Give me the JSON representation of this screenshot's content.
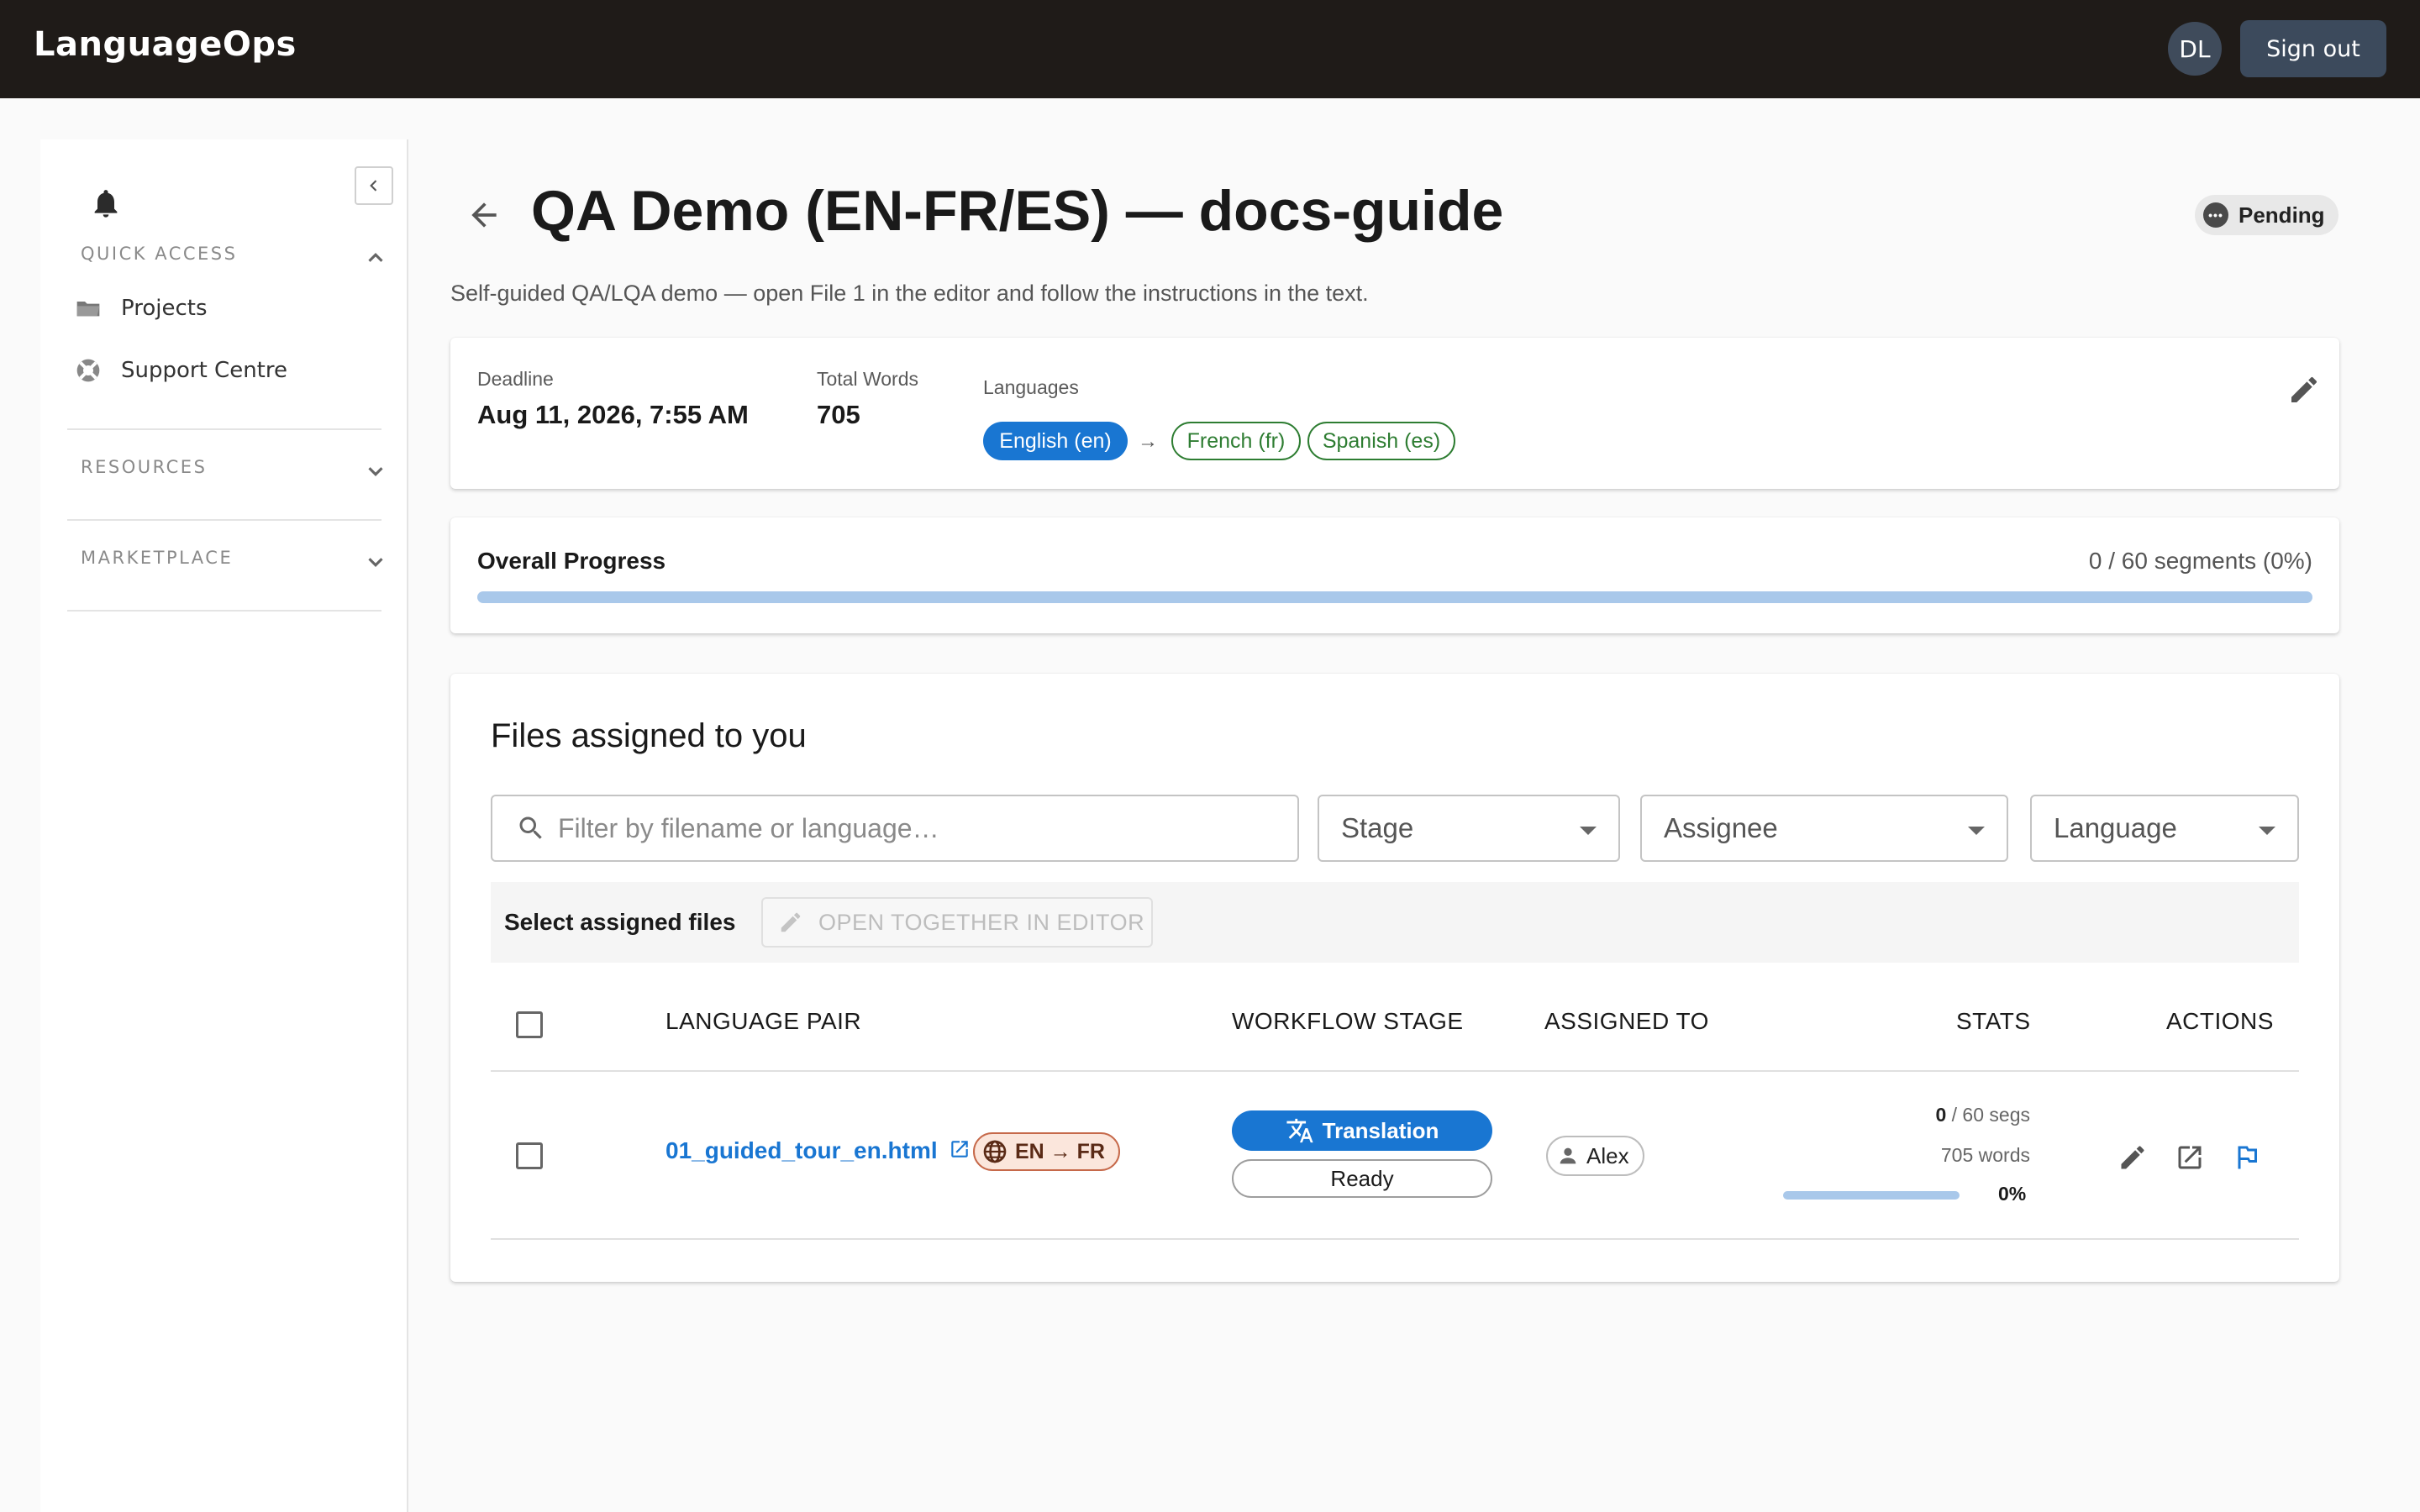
{
  "app": {
    "brand": "LanguageOps"
  },
  "user": {
    "initials": "DL",
    "signout_label": "Sign out"
  },
  "sidebar": {
    "sections": [
      {
        "title": "QUICK ACCESS",
        "expanded": true,
        "items": [
          {
            "label": "Projects",
            "icon": "folder-icon"
          },
          {
            "label": "Support Centre",
            "icon": "lifebuoy-icon"
          }
        ]
      },
      {
        "title": "RESOURCES",
        "expanded": false
      },
      {
        "title": "MARKETPLACE",
        "expanded": false
      }
    ]
  },
  "project": {
    "title": "QA Demo (EN-FR/ES) — docs-guide",
    "status": "Pending",
    "description": "Self-guided QA/LQA demo — open File 1 in the editor and follow the instructions in the text.",
    "meta": {
      "deadline_label": "Deadline",
      "deadline_value": "Aug 11, 2026, 7:55 AM",
      "words_label": "Total Words",
      "words_value": "705",
      "languages_label": "Languages",
      "source_language": "English (en)",
      "arrow": "→",
      "target_languages": [
        "French (fr)",
        "Spanish (es)"
      ]
    }
  },
  "progress": {
    "title": "Overall Progress",
    "text": "0 / 60 segments (0%)",
    "fraction": 0
  },
  "files": {
    "title": "Files assigned to you",
    "search_placeholder": "Filter by filename or language…",
    "filters": {
      "stage": "Stage",
      "assignee": "Assignee",
      "language": "Language"
    },
    "bulk": {
      "label": "Select assigned files",
      "button": "OPEN TOGETHER IN EDITOR"
    },
    "columns": [
      "LANGUAGE PAIR",
      "WORKFLOW STAGE",
      "ASSIGNED TO",
      "STATS",
      "ACTIONS"
    ],
    "rows": [
      {
        "filename": "01_guided_tour_en.html",
        "pair": "EN → FR",
        "stage": "Translation",
        "stage_status": "Ready",
        "assignee": "Alex",
        "segs_done": "0",
        "segs_total": " / 60 segs",
        "words": "705 words",
        "percent": "0%",
        "fraction": 0
      }
    ]
  },
  "colors": {
    "primary": "#1976d2",
    "topbar": "#1f1b18",
    "target_chip": "#2e7d32",
    "pair_badge_bg": "#fbe6dc"
  }
}
